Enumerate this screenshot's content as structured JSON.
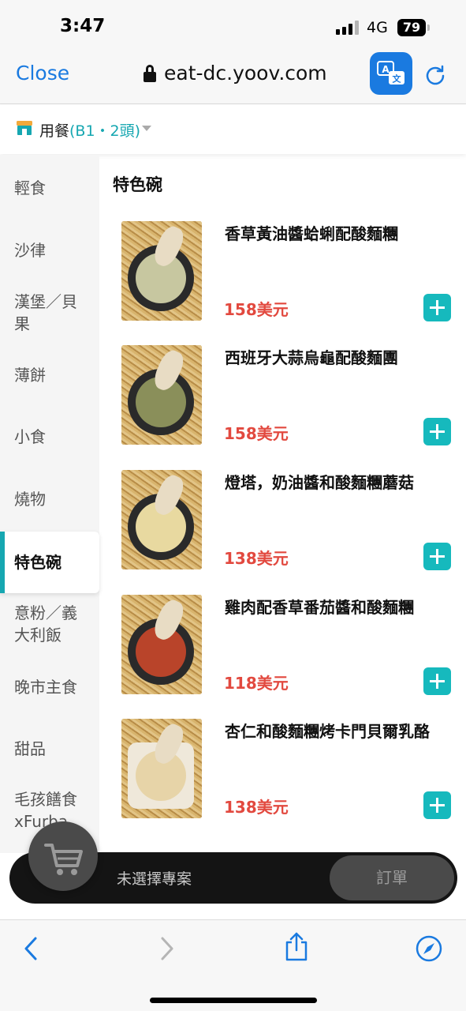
{
  "status_bar": {
    "time": "3:47",
    "network": "4G",
    "battery": "79"
  },
  "browser": {
    "close_label": "Close",
    "url": "eat-dc.yoov.com"
  },
  "order_bar": {
    "label": "用餐",
    "table": "(B1・2頭)"
  },
  "sidebar": {
    "active_index": 6,
    "items": [
      {
        "label": "輕食"
      },
      {
        "label": "沙律"
      },
      {
        "label": "漢堡／貝果"
      },
      {
        "label": "薄餅"
      },
      {
        "label": "小食"
      },
      {
        "label": "燒物"
      },
      {
        "label": "特色碗"
      },
      {
        "label": "意粉／義大利飯"
      },
      {
        "label": "晚市主食"
      },
      {
        "label": "甜品"
      },
      {
        "label": "毛孩饍食xFurba"
      }
    ]
  },
  "section": {
    "title": "特色碗"
  },
  "items": [
    {
      "name": "香草黃油醬蛤蜊配酸麵糰",
      "price": "158美元",
      "food_color": "#c7c7a0"
    },
    {
      "name": "西班牙大蒜烏龜配酸麵團",
      "price": "158美元",
      "food_color": "#8a8f5a"
    },
    {
      "name": "燈塔，奶油醬和酸麵糰蘑菇",
      "price": "138美元",
      "food_color": "#e8d9a0"
    },
    {
      "name": "雞肉配香草番茄醬和酸麵糰",
      "price": "118美元",
      "food_color": "#b9442a"
    },
    {
      "name": "杏仁和酸麵糰烤卡門貝爾乳酪",
      "price": "138美元",
      "food_color": "#e7d4a8"
    }
  ],
  "cart": {
    "status": "未選擇專案",
    "order_label": "訂單"
  },
  "colors": {
    "accent": "#16a7b1",
    "price": "#e2493f",
    "link": "#1a7ae0"
  }
}
